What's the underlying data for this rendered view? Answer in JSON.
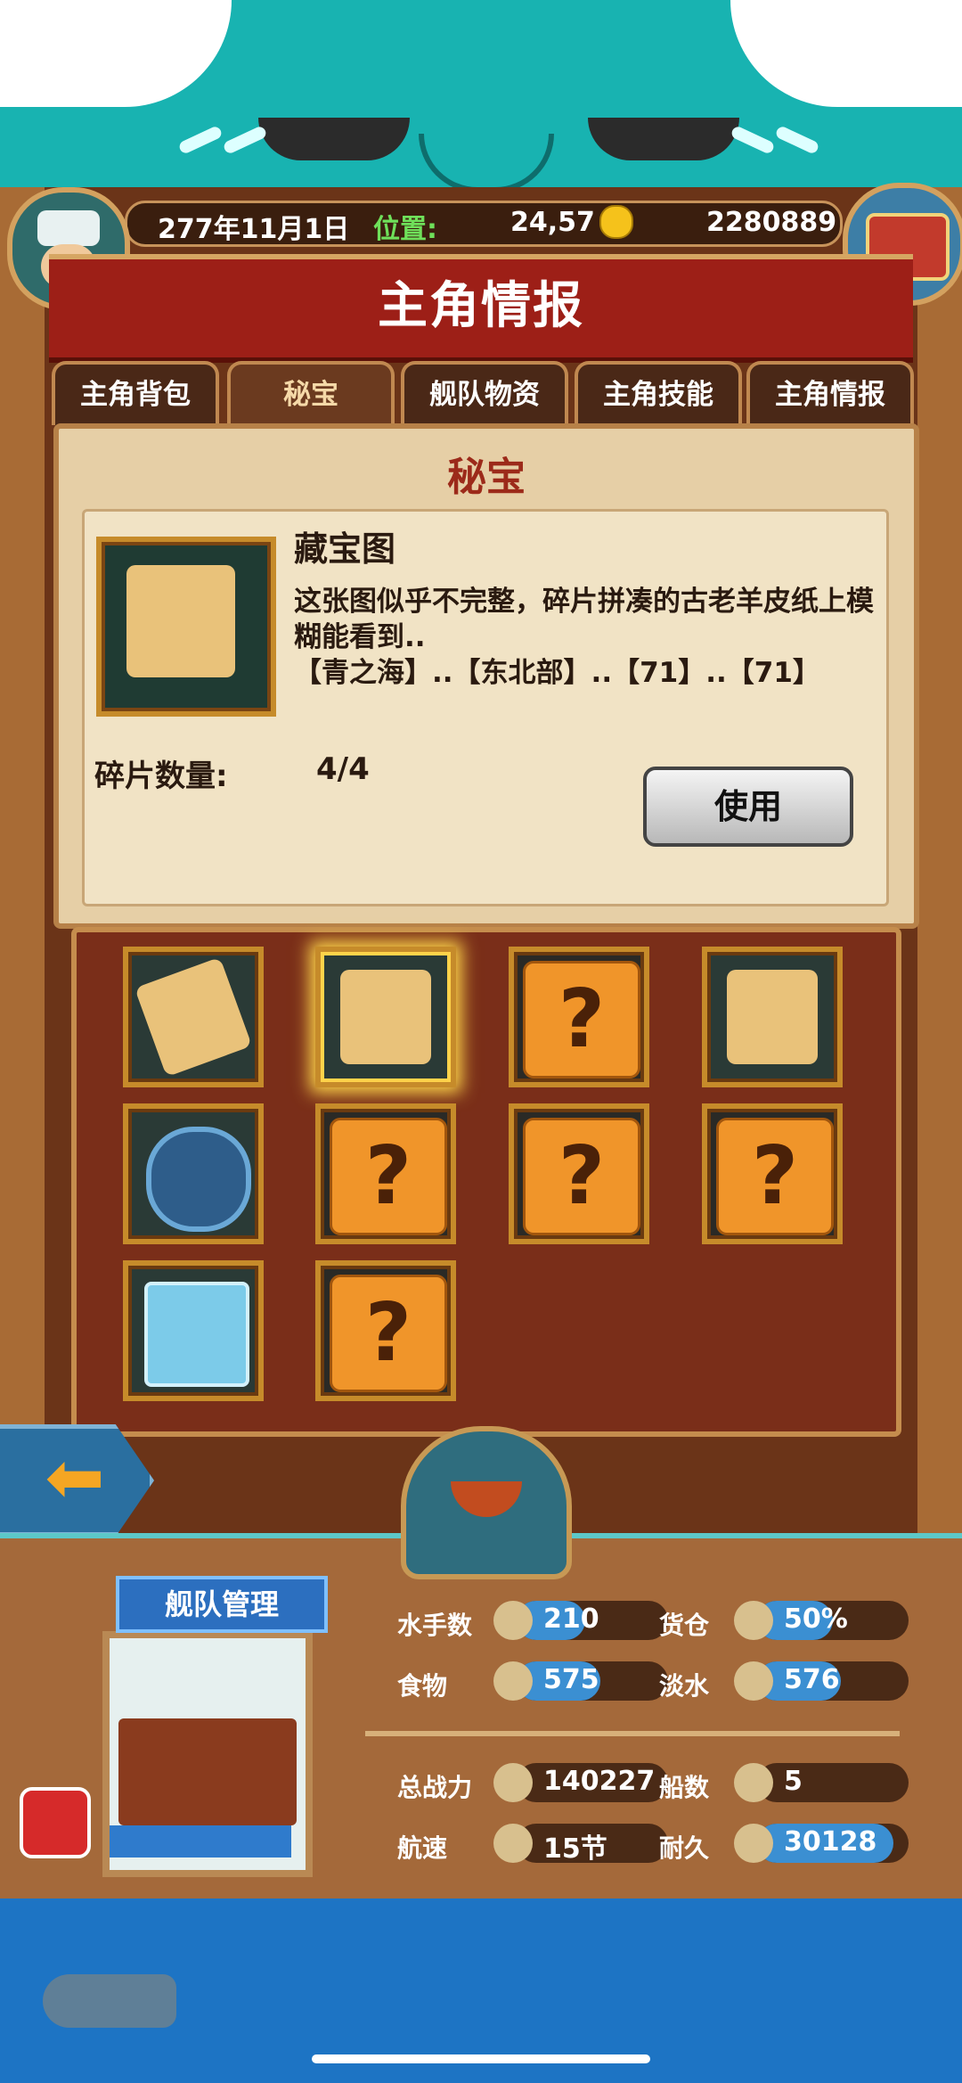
{
  "status": {
    "date": "277年11月1日",
    "location_label": "位置:",
    "location_value": "24,57",
    "gold": "2280889"
  },
  "title": "主角情报",
  "tabs": [
    {
      "label": "主角背包",
      "active": false
    },
    {
      "label": "秘宝",
      "active": true
    },
    {
      "label": "舰队物资",
      "active": false
    },
    {
      "label": "主角技能",
      "active": false
    },
    {
      "label": "主角情报",
      "active": false
    }
  ],
  "secret": {
    "heading": "秘宝",
    "item_name": "藏宝图",
    "description_line1": "这张图似乎不完整，碎片拼凑的古老羊皮纸上模糊能看到..",
    "description_line2": "【青之海】..【东北部】..【71】..【71】",
    "fragment_label": "碎片数量:",
    "fragment_value": "4/4",
    "use_button": "使用"
  },
  "grid_slots": [
    {
      "icon": "torn-map-icon",
      "known": true
    },
    {
      "icon": "treasure-map-icon",
      "known": true,
      "selected": true
    },
    {
      "icon": "question-icon",
      "known": false
    },
    {
      "icon": "treasure-map-icon",
      "known": true
    },
    {
      "icon": "compass-shield-icon",
      "known": true
    },
    {
      "icon": "question-icon",
      "known": false
    },
    {
      "icon": "question-icon",
      "known": false
    },
    {
      "icon": "question-icon",
      "known": false
    },
    {
      "icon": "ice-cube-icon",
      "known": true
    },
    {
      "icon": "question-icon",
      "known": false
    }
  ],
  "question_mark": "?",
  "back_arrow": "⬅",
  "fleet": {
    "title": "舰队管理",
    "stats": [
      {
        "label": "水手数",
        "value": "210",
        "fill": 0.45
      },
      {
        "label": "货仓",
        "value": "50%",
        "fill": 0.5
      },
      {
        "label": "食物",
        "value": "575",
        "fill": 0.55
      },
      {
        "label": "淡水",
        "value": "576",
        "fill": 0.55
      },
      {
        "label": "总战力",
        "value": "140227",
        "fill": 0
      },
      {
        "label": "船数",
        "value": "5",
        "fill": 0
      },
      {
        "label": "航速",
        "value": "15节",
        "fill": 0
      },
      {
        "label": "耐久",
        "value": "30128",
        "fill": 0.9
      }
    ]
  },
  "colors": {
    "accent": "#9d1f17",
    "teal": "#18b3b1",
    "gold": "#c68b2a"
  }
}
